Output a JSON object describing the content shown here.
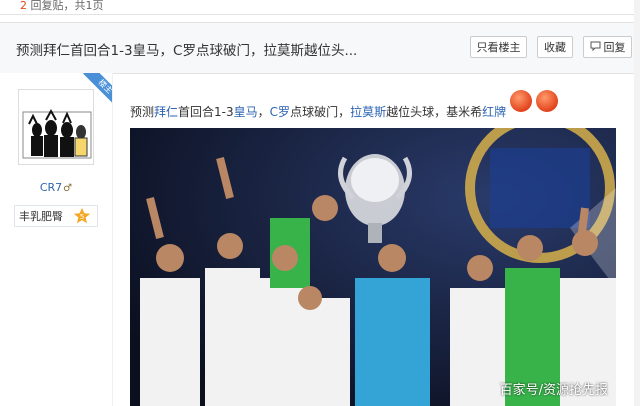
{
  "topbar": {
    "reply_count": "2",
    "reply_label": "回复贴，共",
    "pages": "1",
    "pages_suffix": "页"
  },
  "thread": {
    "title": "预测拜仁首回合1-3皇马，C罗点球破门，拉莫斯越位头...",
    "buttons": {
      "only_op": "只看楼主",
      "favorite": "收藏",
      "reply": "回复"
    }
  },
  "author": {
    "name": "CR7",
    "badge_text": "丰乳肥臀",
    "badge_level": "5",
    "corner_tag": "楼主"
  },
  "post": {
    "segments": [
      "预测",
      "拜仁",
      "首回合1-3",
      "皇马",
      "，",
      "C罗",
      "点球破门，",
      "拉莫斯",
      "越位头球，基米希",
      "红牌"
    ],
    "emoticon": "face-emoticon"
  },
  "image": {
    "watermark": "百家号/资源抢先报",
    "subject": "Real Madrid team celebrating with Champions League trophy"
  },
  "colors": {
    "link": "#2d64b3",
    "accent": "#e64a19",
    "header_bg": "#f7f8fa",
    "badge_star": "#f5a623"
  }
}
